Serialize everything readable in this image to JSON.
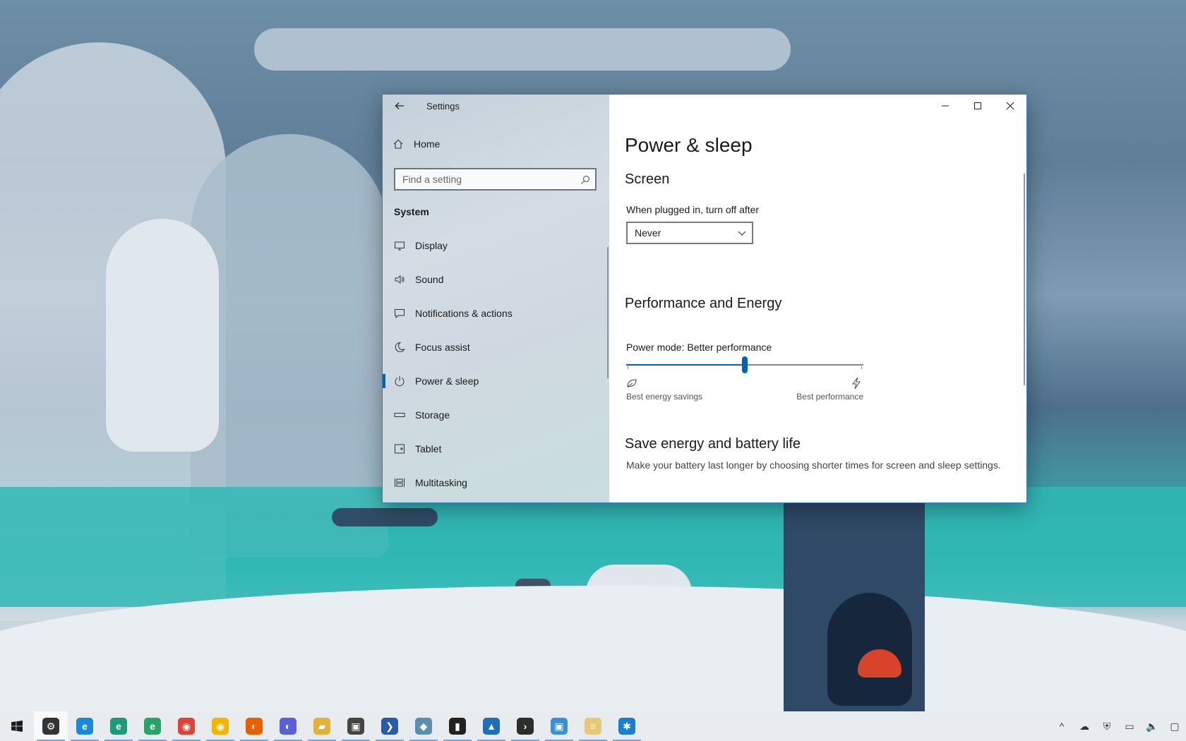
{
  "window": {
    "title": "Settings",
    "back_label": "←",
    "minimize_label": "—",
    "maximize_label": "☐",
    "close_label": "✕"
  },
  "nav": {
    "home_label": "Home",
    "search_placeholder": "Find a setting",
    "section_label": "System",
    "items": [
      {
        "label": "Display",
        "icon": "monitor-icon",
        "active": false
      },
      {
        "label": "Sound",
        "icon": "speaker-icon",
        "active": false
      },
      {
        "label": "Notifications & actions",
        "icon": "notification-icon",
        "active": false
      },
      {
        "label": "Focus assist",
        "icon": "moon-icon",
        "active": false
      },
      {
        "label": "Power & sleep",
        "icon": "power-icon",
        "active": true
      },
      {
        "label": "Storage",
        "icon": "storage-icon",
        "active": false
      },
      {
        "label": "Tablet",
        "icon": "tablet-icon",
        "active": false
      },
      {
        "label": "Multitasking",
        "icon": "multitasking-icon",
        "active": false
      }
    ]
  },
  "content": {
    "page_title": "Power & sleep",
    "screen_heading": "Screen",
    "plugged_in_label": "When plugged in, turn off after",
    "plugged_in_value": "Never",
    "performance_heading": "Performance and Energy",
    "power_mode_label": "Power mode: Better performance",
    "power_mode_level": 0.5,
    "best_energy_label": "Best energy savings",
    "best_performance_label": "Best performance",
    "save_energy_heading": "Save energy and battery life",
    "save_energy_desc": "Make your battery last longer by choosing shorter times for screen and sleep settings."
  },
  "colors": {
    "accent": "#0063b1",
    "window_border": "#3a7bc8"
  },
  "taskbar": {
    "apps": [
      {
        "name": "settings",
        "icon": "gear-icon",
        "glyph": "⚙",
        "color": "#333333",
        "active": true
      },
      {
        "name": "edge",
        "icon": "edge-icon",
        "glyph": "e",
        "color": "#1a8ad4"
      },
      {
        "name": "edge-dev",
        "icon": "edge-dev-icon",
        "glyph": "e",
        "color": "#1d9a7a"
      },
      {
        "name": "edge-canary",
        "icon": "edge-canary-icon",
        "glyph": "e",
        "color": "#2aa36b"
      },
      {
        "name": "chrome",
        "icon": "chrome-icon",
        "glyph": "◉",
        "color": "#db4437"
      },
      {
        "name": "chrome-canary",
        "icon": "chrome-canary-icon",
        "glyph": "◉",
        "color": "#f4b400"
      },
      {
        "name": "firefox",
        "icon": "firefox-icon",
        "glyph": "◐",
        "color": "#e66000"
      },
      {
        "name": "firefox-dev",
        "icon": "firefox-dev-icon",
        "glyph": "◐",
        "color": "#5b5fd6"
      },
      {
        "name": "file-explorer",
        "icon": "folder-icon",
        "glyph": "▰",
        "color": "#e2b13c"
      },
      {
        "name": "store",
        "icon": "store-icon",
        "glyph": "▣",
        "color": "#444444"
      },
      {
        "name": "powershell",
        "icon": "powershell-icon",
        "glyph": "❯",
        "color": "#2a5ba8"
      },
      {
        "name": "feedback",
        "icon": "feedback-icon",
        "glyph": "◆",
        "color": "#5b8fb0"
      },
      {
        "name": "command-prompt",
        "icon": "terminal-icon",
        "glyph": "▮",
        "color": "#222222"
      },
      {
        "name": "photos",
        "icon": "photos-icon",
        "glyph": "▲",
        "color": "#1f6fb8"
      },
      {
        "name": "terminal",
        "icon": "terminal-app-icon",
        "glyph": "›",
        "color": "#2d2d2d"
      },
      {
        "name": "remote-desktop",
        "icon": "remote-desktop-icon",
        "glyph": "▣",
        "color": "#3c8fd0"
      },
      {
        "name": "notepad",
        "icon": "notepad-icon",
        "glyph": "≡",
        "color": "#e8c878"
      },
      {
        "name": "snip",
        "icon": "gear-app-icon",
        "glyph": "✱",
        "color": "#1a7fd0"
      }
    ],
    "tray": [
      {
        "icon": "chevron-up-icon",
        "glyph": "^"
      },
      {
        "icon": "onedrive-icon",
        "glyph": "☁"
      },
      {
        "icon": "security-icon",
        "glyph": "⛨"
      },
      {
        "icon": "network-icon",
        "glyph": "▭"
      },
      {
        "icon": "volume-icon",
        "glyph": "🔈"
      },
      {
        "icon": "action-center-icon",
        "glyph": "▢"
      }
    ]
  }
}
